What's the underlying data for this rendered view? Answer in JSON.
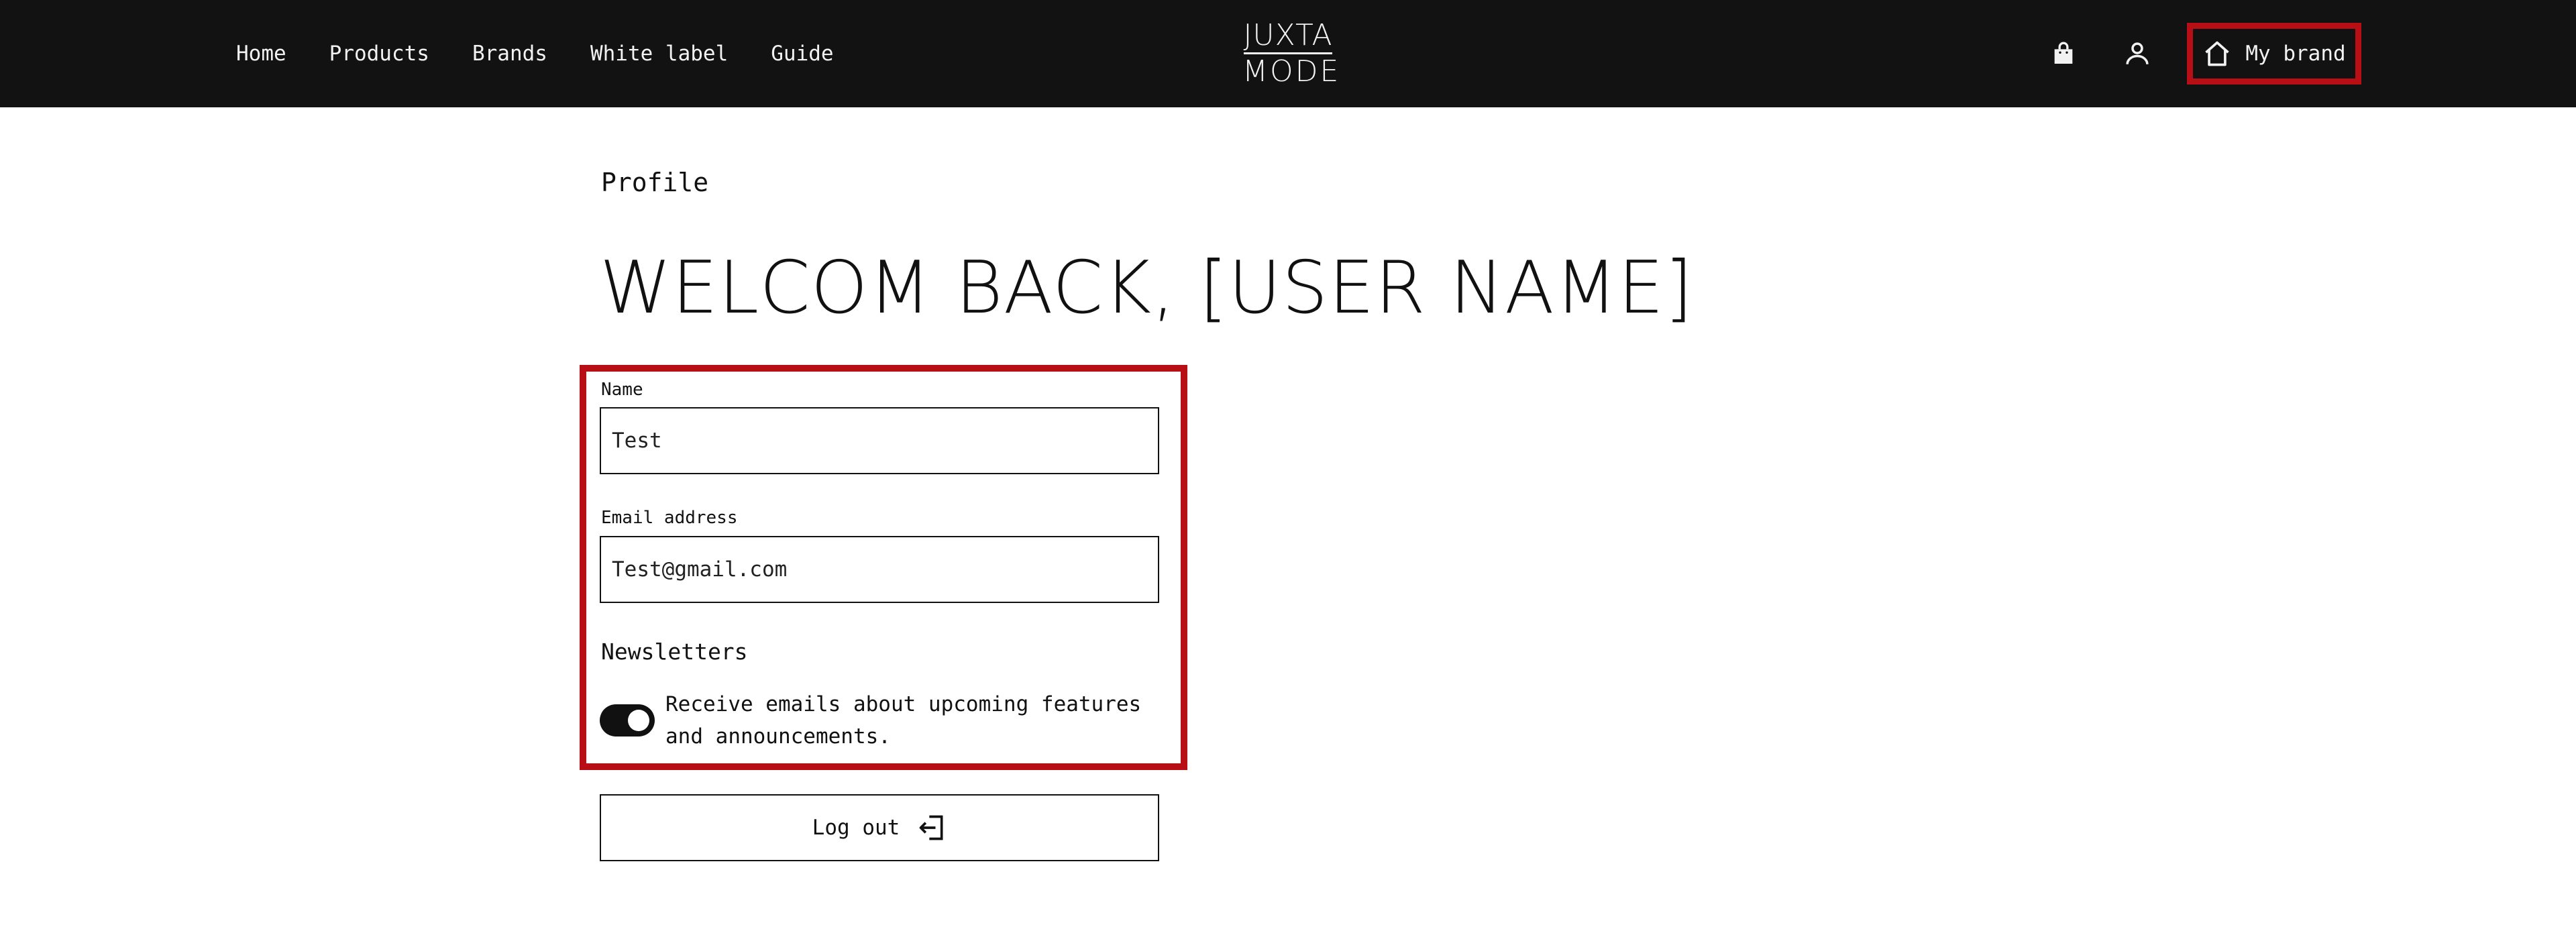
{
  "header": {
    "nav": [
      "Home",
      "Products",
      "Brands",
      "White label",
      "Guide"
    ],
    "logo": {
      "line1": "JUXTA",
      "line2": "MODE"
    },
    "icons": {
      "cart": "shopping-bag-icon",
      "account": "user-icon",
      "brand": "home-icon"
    },
    "my_brand_label": "My brand"
  },
  "main": {
    "breadcrumb": "Profile",
    "title": "WELCOM BACK, [USER NAME]",
    "form": {
      "name_label": "Name",
      "name_value": "Test",
      "email_label": "Email address",
      "email_value": "Test@gmail.com",
      "newsletters_heading": "Newsletters",
      "newsletter_toggle_on": true,
      "newsletter_text": "Receive emails about upcoming features and announcements."
    },
    "logout_label": "Log out"
  },
  "colors": {
    "header_bg": "#121212",
    "highlight": "#b80f17",
    "text": "#111111"
  }
}
